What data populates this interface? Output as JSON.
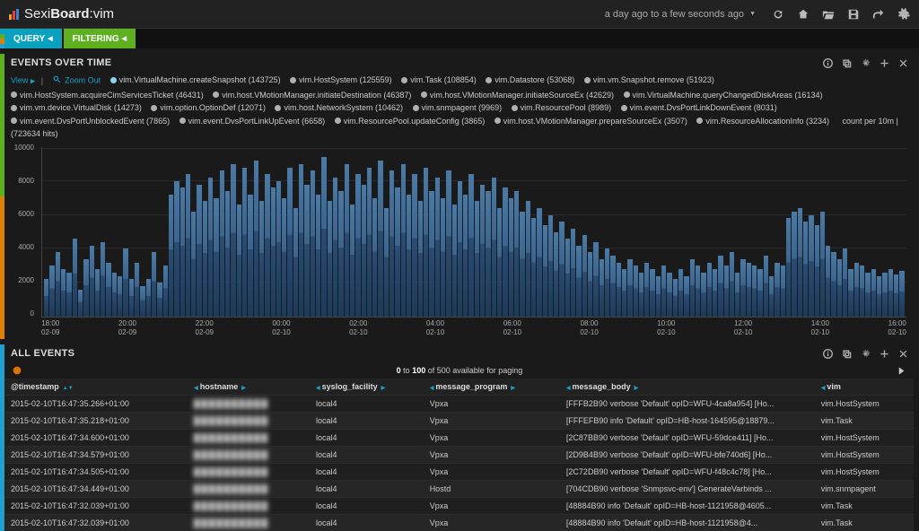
{
  "header": {
    "brand_prefix": "Sexi",
    "brand_mid": "Board",
    "brand_suffix": ":vim",
    "time_range": "a day ago to a few seconds ago"
  },
  "subnav": {
    "query_label": "QUERY",
    "filter_label": "FILTERING"
  },
  "chart_panel": {
    "title": "EVENTS OVER TIME",
    "view_label": "View",
    "zoom_label": "Zoom Out",
    "count_per_label": "count per 10m | (723634 hits)",
    "legend": [
      {
        "color": "#8ed4e6",
        "label": "vim.VirtualMachine.createSnapshot (143725)"
      },
      {
        "color": "#b0b0b0",
        "label": "vim.HostSystem (125559)"
      },
      {
        "color": "#b0b0b0",
        "label": "vim.Task (108854)"
      },
      {
        "color": "#b0b0b0",
        "label": "vim.Datastore (53068)"
      },
      {
        "color": "#b0b0b0",
        "label": "vim.vm.Snapshot.remove (51923)"
      },
      {
        "color": "#b0b0b0",
        "label": "vim.HostSystem.acquireCimServicesTicket (46431)"
      },
      {
        "color": "#b0b0b0",
        "label": "vim.host.VMotionManager.initiateDestination (46387)"
      },
      {
        "color": "#b0b0b0",
        "label": "vim.host.VMotionManager.initiateSourceEx (42629)"
      },
      {
        "color": "#b0b0b0",
        "label": "vim.VirtualMachine.queryChangedDiskAreas (16134)"
      },
      {
        "color": "#b0b0b0",
        "label": "vim.vm.device.VirtualDisk (14273)"
      },
      {
        "color": "#b0b0b0",
        "label": "vim.option.OptionDef (12071)"
      },
      {
        "color": "#b0b0b0",
        "label": "vim.host.NetworkSystem (10462)"
      },
      {
        "color": "#b0b0b0",
        "label": "vim.snmpagent (9969)"
      },
      {
        "color": "#b0b0b0",
        "label": "vim.ResourcePool (8989)"
      },
      {
        "color": "#b0b0b0",
        "label": "vim.event.DvsPortLinkDownEvent (8031)"
      },
      {
        "color": "#b0b0b0",
        "label": "vim.event.DvsPortUnblockedEvent (7865)"
      },
      {
        "color": "#b0b0b0",
        "label": "vim.event.DvsPortLinkUpEvent (6658)"
      },
      {
        "color": "#b0b0b0",
        "label": "vim.ResourcePool.updateConfig (3865)"
      },
      {
        "color": "#b0b0b0",
        "label": "vim.host.VMotionManager.prepareSourceEx (3507)"
      },
      {
        "color": "#b0b0b0",
        "label": "vim.ResourceAllocationInfo (3234)"
      }
    ]
  },
  "chart_data": {
    "type": "bar",
    "title": "EVENTS OVER TIME",
    "ylabel": "",
    "xlabel": "",
    "ylim": [
      0,
      10000
    ],
    "y_ticks": [
      0,
      2000,
      4000,
      6000,
      8000,
      10000
    ],
    "x_ticks": [
      {
        "time": "18:00",
        "date": "02-09"
      },
      {
        "time": "20:00",
        "date": "02-09"
      },
      {
        "time": "22:00",
        "date": "02-09"
      },
      {
        "time": "00:00",
        "date": "02-10"
      },
      {
        "time": "02:00",
        "date": "02-10"
      },
      {
        "time": "04:00",
        "date": "02-10"
      },
      {
        "time": "06:00",
        "date": "02-10"
      },
      {
        "time": "08:00",
        "date": "02-10"
      },
      {
        "time": "10:00",
        "date": "02-10"
      },
      {
        "time": "12:00",
        "date": "02-10"
      },
      {
        "time": "14:00",
        "date": "02-10"
      },
      {
        "time": "16:00",
        "date": "02-10"
      }
    ],
    "values": [
      2200,
      3000,
      3800,
      2800,
      2600,
      4600,
      1600,
      3400,
      4200,
      2800,
      4400,
      3200,
      2600,
      2400,
      4000,
      2200,
      3200,
      1800,
      2200,
      3800,
      2000,
      3000,
      7200,
      8000,
      7600,
      8400,
      6200,
      7800,
      6800,
      8200,
      7000,
      8600,
      7400,
      9000,
      6600,
      8800,
      7200,
      9200,
      6800,
      8400,
      7600,
      8000,
      7000,
      8800,
      6400,
      9000,
      7800,
      8600,
      7200,
      9400,
      6800,
      8200,
      7400,
      9000,
      6600,
      8400,
      7800,
      8800,
      7000,
      9200,
      6400,
      8600,
      7600,
      9000,
      7200,
      8400,
      6800,
      8800,
      7400,
      8200,
      7000,
      8600,
      6600,
      8000,
      7200,
      8400,
      6800,
      7800,
      7400,
      8200,
      6400,
      7600,
      7000,
      7400,
      6200,
      6800,
      5800,
      6400,
      5400,
      6000,
      5000,
      5600,
      4600,
      5200,
      4200,
      4800,
      3800,
      4400,
      3400,
      4000,
      3600,
      3200,
      2800,
      3400,
      3000,
      2600,
      3200,
      2800,
      2400,
      3000,
      2600,
      2200,
      2800,
      2400,
      3400,
      3000,
      2600,
      3200,
      2800,
      3600,
      3000,
      3800,
      2600,
      3400,
      3200,
      3000,
      2800,
      3600,
      2400,
      3200,
      3000,
      5800,
      6200,
      6400,
      5600,
      6000,
      5400,
      6200,
      4200,
      3800,
      3400,
      4000,
      2800,
      3200,
      3000,
      2600,
      2800,
      2400,
      2600,
      2800,
      2500,
      2700
    ]
  },
  "table_panel": {
    "title": "ALL EVENTS",
    "paging_from": "0",
    "paging_to": "100",
    "paging_of": "of 500 available for paging",
    "columns": {
      "timestamp": "@timestamp",
      "hostname": "hostname",
      "syslog_facility": "syslog_facility",
      "message_program": "message_program",
      "message_body": "message_body",
      "vim": "vim"
    },
    "rows": [
      {
        "timestamp": "2015-02-10T16:47:35.266+01:00",
        "hostname": "██████████",
        "syslog_facility": "local4",
        "message_program": "Vpxa",
        "message_body": "[FFFB2B90 verbose 'Default' opID=WFU-4ca8a954] [Ho...",
        "vim": "vim.HostSystem"
      },
      {
        "timestamp": "2015-02-10T16:47:35.218+01:00",
        "hostname": "██████████",
        "syslog_facility": "local4",
        "message_program": "Vpxa",
        "message_body": "[FFFEFB90 info 'Default' opID=HB-host-164595@18879...",
        "vim": "vim.Task"
      },
      {
        "timestamp": "2015-02-10T16:47:34.600+01:00",
        "hostname": "██████████",
        "syslog_facility": "local4",
        "message_program": "Vpxa",
        "message_body": "[2C87BB90 verbose 'Default' opID=WFU-59dce411] [Ho...",
        "vim": "vim.HostSystem"
      },
      {
        "timestamp": "2015-02-10T16:47:34.579+01:00",
        "hostname": "██████████",
        "syslog_facility": "local4",
        "message_program": "Vpxa",
        "message_body": "[2D9B4B90 verbose 'Default' opID=WFU-bfe740d6] [Ho...",
        "vim": "vim.HostSystem"
      },
      {
        "timestamp": "2015-02-10T16:47:34.505+01:00",
        "hostname": "██████████",
        "syslog_facility": "local4",
        "message_program": "Vpxa",
        "message_body": "[2C72DB90 verbose 'Default' opID=WFU-f48c4c78] [Ho...",
        "vim": "vim.HostSystem"
      },
      {
        "timestamp": "2015-02-10T16:47:34.449+01:00",
        "hostname": "██████████",
        "syslog_facility": "local4",
        "message_program": "Hostd",
        "message_body": "[704CDB90 verbose 'Snmpsvc-env'] GenerateVarbinds ...",
        "vim": "vim.snmpagent"
      },
      {
        "timestamp": "2015-02-10T16:47:32.039+01:00",
        "hostname": "██████████",
        "syslog_facility": "local4",
        "message_program": "Vpxa",
        "message_body": "[48884B90 info 'Default' opID=HB-host-1121958@4605...",
        "vim": "vim.Task"
      },
      {
        "timestamp": "2015-02-10T16:47:32.039+01:00",
        "hostname": "██████████",
        "syslog_facility": "local4",
        "message_program": "Vpxa",
        "message_body": "[48884B90 info 'Default' opID=HB-host-1121958@4...",
        "vim": "vim.Task"
      }
    ]
  }
}
